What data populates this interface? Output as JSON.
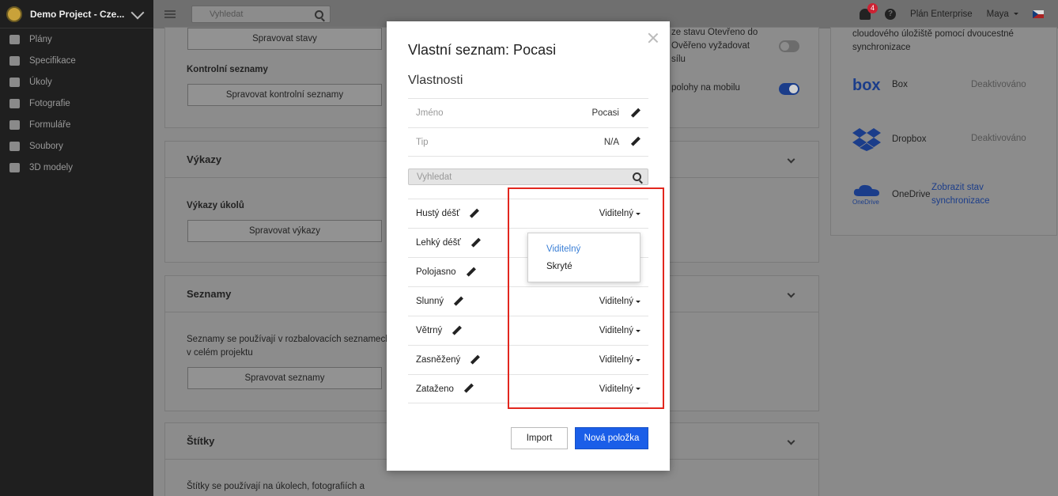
{
  "sidebar": {
    "project": "Demo Project - Cze...",
    "items": [
      {
        "label": "Plány",
        "icon": "map-icon"
      },
      {
        "label": "Specifikace",
        "icon": "document-icon"
      },
      {
        "label": "Úkoly",
        "icon": "list-icon"
      },
      {
        "label": "Fotografie",
        "icon": "camera-icon"
      },
      {
        "label": "Formuláře",
        "icon": "clipboard-icon"
      },
      {
        "label": "Soubory",
        "icon": "paperclip-icon"
      },
      {
        "label": "3D modely",
        "icon": "cube-icon"
      }
    ]
  },
  "topbar": {
    "search_placeholder": "Vyhledat",
    "notification_count": "4",
    "help": "?",
    "plan": "Plán Enterprise",
    "user": "Maya"
  },
  "background": {
    "manage_states": "Spravovat stavy",
    "checklists_label": "Kontrolní seznamy",
    "manage_checklists": "Spravovat kontrolní seznamy",
    "reports_title": "Výkazy",
    "task_reports_label": "Výkazy úkolů",
    "manage_reports": "Spravovat výkazy",
    "lists_title": "Seznamy",
    "lists_desc_1": "Seznamy se používají v rozbalovacích seznamech",
    "lists_desc_2": "v celém projektu",
    "manage_lists": "Spravovat seznamy",
    "tags_title": "Štítky",
    "tags_desc": "Štítky se používají na úkolech, fotografiích a",
    "setting_text_1": "ze stavu Otevřeno do",
    "setting_text_2": "Ověřeno vyžadovat",
    "setting_text_3": "sílu",
    "setting_text_4": "polohy na mobilu",
    "storage_desc_1": "cloudového úložiště pomocí dvoucestné",
    "storage_desc_2": "synchronizace",
    "storage": [
      {
        "logo": "box",
        "name": "Box",
        "status": "Deaktivováno"
      },
      {
        "logo": "dropbox-icon",
        "name": "Dropbox",
        "status": "Deaktivováno"
      },
      {
        "logo": "OneDrive",
        "name": "OneDrive",
        "link_1": "Zobrazit stav",
        "link_2": "synchronizace"
      }
    ]
  },
  "modal": {
    "title": "Vlastní seznam: Pocasi",
    "section": "Vlastnosti",
    "properties": [
      {
        "key": "Jméno",
        "value": "Pocasi"
      },
      {
        "key": "Tip",
        "value": "N/A"
      }
    ],
    "search_placeholder": "Vyhledat",
    "items": [
      {
        "name": "Hustý déšť",
        "visibility": "Viditelný"
      },
      {
        "name": "Lehký déšť",
        "visibility": ""
      },
      {
        "name": "Polojasno",
        "visibility": ""
      },
      {
        "name": "Slunný",
        "visibility": "Viditelný"
      },
      {
        "name": "Větrný",
        "visibility": "Viditelný"
      },
      {
        "name": "Zasněžený",
        "visibility": "Viditelný"
      },
      {
        "name": "Zataženo",
        "visibility": "Viditelný"
      }
    ],
    "dropdown": {
      "selected": "Viditelný",
      "other": "Skryté"
    },
    "import_label": "Import",
    "new_item_label": "Nová položka"
  },
  "colors": {
    "primary": "#1a5ee8",
    "highlight": "#e2271e",
    "dropdown_selected": "#3a7fd6"
  }
}
